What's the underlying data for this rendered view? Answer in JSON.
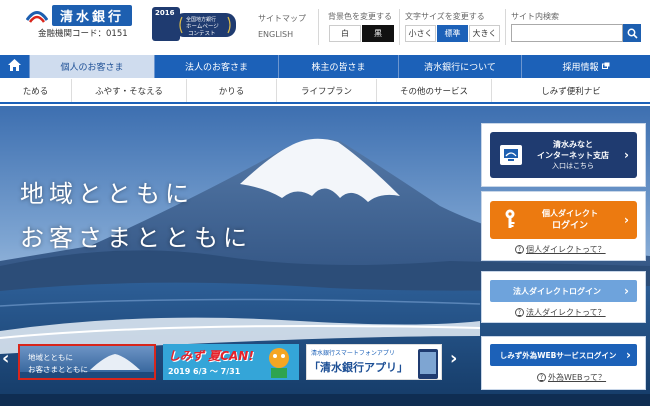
{
  "header": {
    "bank_name": "清水銀行",
    "bank_code": "金融機関コード：0151",
    "award_year": "2016",
    "award_line1": "全国地方銀行",
    "award_line2": "ホームページ",
    "award_line3": "コンテスト",
    "sitemap": "サイトマップ",
    "english": "ENGLISH",
    "bgcolor_label": "背景色を変更する",
    "bg_white": "白",
    "bg_black": "黒",
    "fontsize_label": "文字サイズを変更する",
    "fs_small": "小さく",
    "fs_normal": "標準",
    "fs_large": "大きく",
    "search_label": "サイト内検索",
    "search_placeholder": ""
  },
  "nav_main": [
    {
      "label": "個人のお客さま"
    },
    {
      "label": "法人のお客さま"
    },
    {
      "label": "株主の皆さま"
    },
    {
      "label": "清水銀行について"
    },
    {
      "label": "採用情報"
    }
  ],
  "nav_sub": [
    {
      "label": "ためる"
    },
    {
      "label": "ふやす・そなえる"
    },
    {
      "label": "かりる"
    },
    {
      "label": "ライフプラン"
    },
    {
      "label": "その他のサービス"
    },
    {
      "label": "しみず便利ナビ"
    }
  ],
  "hero": {
    "line1": "地域とともに",
    "line2": "お客さまとともに"
  },
  "right_panel": {
    "internet_branch_line1": "清水みなと",
    "internet_branch_line2": "インターネット支店",
    "internet_branch_line3": "入口はこちら",
    "personal_direct_line1": "個人ダイレクト",
    "personal_direct_line2": "ログイン",
    "personal_direct_help": "個人ダイレクトって？",
    "corporate_direct": "法人ダイレクトログイン",
    "corporate_direct_help": "法人ダイレクトって？",
    "fx_login": "しみず外為WEBサービスログイン",
    "fx_help": "外為WEBって？"
  },
  "thumbnails": [
    {
      "line1": "地域とともに",
      "line2": "お客さまとともに"
    },
    {
      "title": "しみず 夏CAN!",
      "dates": "2019 6/3 ～ 7/31"
    },
    {
      "title_small": "清水銀行スマートフォンアプリ",
      "title": "「清水銀行アプリ」"
    }
  ],
  "colors": {
    "brand_blue": "#1c61b8",
    "dark_navy": "#1f3b70",
    "orange": "#ec7a10",
    "light_blue": "#6ea3dc"
  }
}
